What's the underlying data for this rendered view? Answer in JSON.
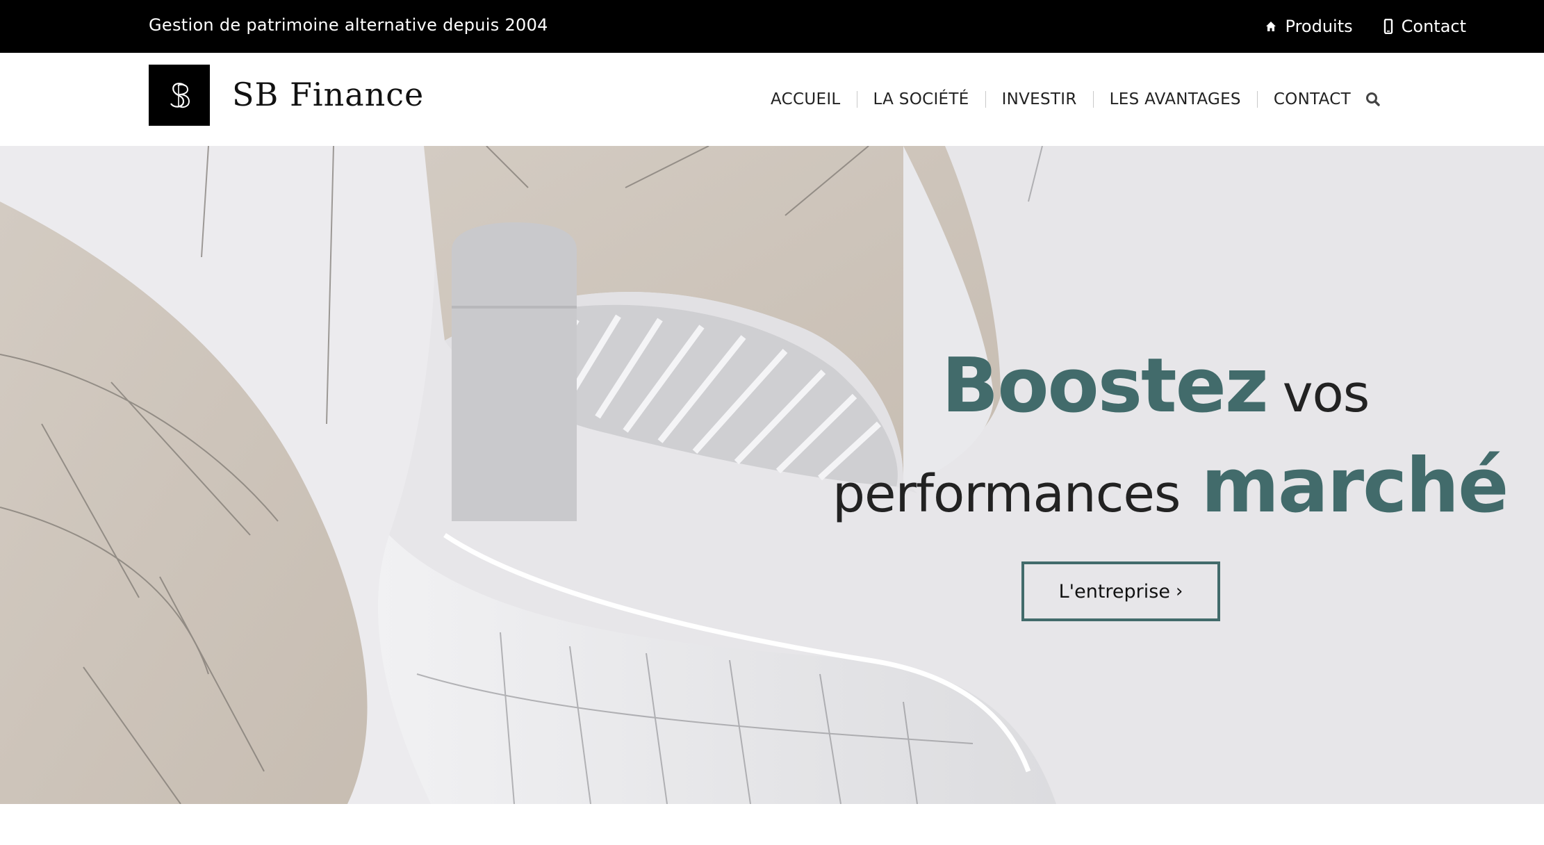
{
  "topbar": {
    "tagline": "Gestion de patrimoine alternative depuis 2004",
    "links": [
      {
        "label": "Produits",
        "icon": "home-icon"
      },
      {
        "label": "Contact",
        "icon": "mobile-phone-icon"
      }
    ]
  },
  "header": {
    "brand": "SB Finance",
    "logo_monogram": "SB",
    "nav": [
      "ACCUEIL",
      "LA SOCIÉTÉ",
      "INVESTIR",
      "LES AVANTAGES",
      "CONTACT"
    ],
    "search_icon": "search-icon"
  },
  "hero": {
    "line1_bold": "Boostez",
    "line1_thin": "vos",
    "line2_thin": "performances",
    "line2_bold": "marché",
    "cta_label": "L'entreprise",
    "cta_icon": "chevron-right-icon"
  },
  "colors": {
    "accent": "#426b6b",
    "topbar_bg": "#000000",
    "hero_bg": "#e7e6e9"
  }
}
